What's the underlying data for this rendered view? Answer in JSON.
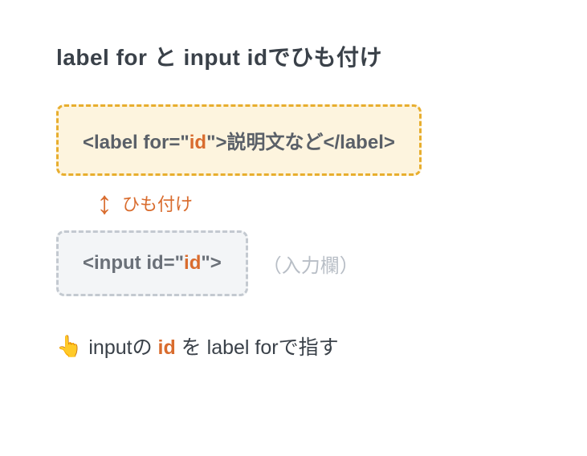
{
  "title": "label for と input idでひも付け",
  "label_example": {
    "prefix": "<label for=\"",
    "id_text": "id",
    "suffix": "\">説明文など</label>"
  },
  "connector": {
    "arrow": "↕",
    "label": "ひも付け"
  },
  "input_example": {
    "prefix": "<input id=\"",
    "id_text": "id",
    "suffix": "\">"
  },
  "input_placeholder_note": "（入力欄）",
  "footer": {
    "emoji": "👆",
    "text_before": " inputの ",
    "id_text": "id",
    "text_after": " を label forで指す"
  }
}
